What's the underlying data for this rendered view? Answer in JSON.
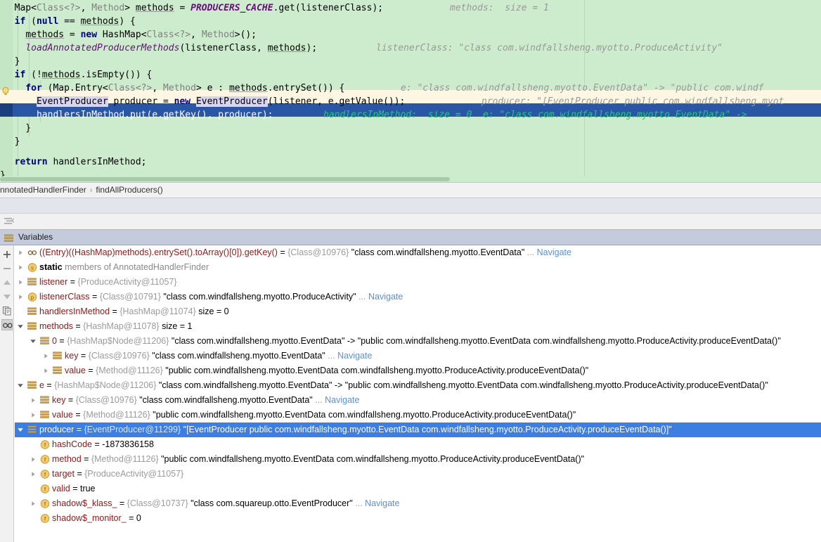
{
  "editor": {
    "lines": [
      {
        "id": "line-1",
        "code": "  Map<Class<?>, Method> methods = PRODUCERS_CACHE.get(listenerClass);",
        "hint": "methods:  size = 1"
      },
      {
        "id": "line-2",
        "code": "  if (null == methods) {",
        "hint": ""
      },
      {
        "id": "line-3",
        "code": "    methods = new HashMap<Class<?>, Method>();",
        "hint": ""
      },
      {
        "id": "line-4",
        "code": "    loadAnnotatedProducerMethods(listenerClass, methods);",
        "hint": "listenerClass: \"class com.windfallsheng.myotto.ProduceActivity\""
      },
      {
        "id": "line-5",
        "code": "  }",
        "hint": ""
      },
      {
        "id": "line-6",
        "code": "  if (!methods.isEmpty()) {",
        "hint": ""
      },
      {
        "id": "line-7",
        "code": "    for (Map.Entry<Class<?>, Method> e : methods.entrySet()) {",
        "hint": "e: \"class com.windfallsheng.myotto.EventData\" -> \"public com.windf"
      },
      {
        "id": "line-8",
        "code": "      EventProducer producer = new EventProducer(listener, e.getValue());",
        "hint": "producer: \"[EventProducer public com.windfallsheng.myot"
      },
      {
        "id": "line-9",
        "code": "      handlersInMethod.put(e.getKey(), producer);",
        "hint": "handlersInMethod:  size = 0  e: \"class com.windfallsheng.myotto.EventData\" ->"
      },
      {
        "id": "line-10",
        "code": "    }",
        "hint": ""
      },
      {
        "id": "line-11",
        "code": "  }",
        "hint": ""
      },
      {
        "id": "line-12",
        "code": "",
        "hint": ""
      },
      {
        "id": "line-13",
        "code": "  return handlersInMethod;",
        "hint": ""
      },
      {
        "id": "line-14",
        "code": "}",
        "hint": ""
      }
    ],
    "colors": {
      "background": "#cdeccd",
      "execution_line": "#2a56a6",
      "frame_line": "#fdf6e3",
      "hint_text": "#999999",
      "hint_text_selected": "#21c97a"
    }
  },
  "breadcrumb": {
    "items": [
      "nnotatedHandlerFinder",
      "findAllProducers()"
    ],
    "separator": "›"
  },
  "toolbar": {
    "sort_icon_name": "sort-lines-icon"
  },
  "variables_panel": {
    "tab_label": "Variables",
    "sidebar_buttons": [
      {
        "name": "add-watch-button",
        "glyph": "+"
      },
      {
        "name": "remove-watch-button",
        "glyph": "−"
      },
      {
        "name": "move-up-button",
        "glyph": "▲"
      },
      {
        "name": "move-down-button",
        "glyph": "▼"
      },
      {
        "name": "copy-value-button",
        "glyph": "⧉"
      },
      {
        "name": "inspect-button",
        "glyph": "∞"
      }
    ],
    "rows": [
      {
        "indent": 0,
        "twisty": "collapsed",
        "icon": "watch-expression-icon",
        "name": "((Entry)((HashMap)methods).entrySet().toArray()[0]).getKey()",
        "eq": " = ",
        "ref": "{Class@10976}",
        "value": "\"class com.windfallsheng.myotto.EventData\"",
        "ellipsis": "...",
        "navigate": "Navigate",
        "selected": false
      },
      {
        "indent": 0,
        "twisty": "collapsed",
        "icon": "static-members-icon",
        "name": "static",
        "eq": "",
        "ref": "",
        "value": "members of AnnotatedHandlerFinder",
        "ellipsis": "",
        "navigate": "",
        "selected": false,
        "style": "static"
      },
      {
        "indent": 0,
        "twisty": "collapsed",
        "icon": "object-icon",
        "name": "listener",
        "eq": " = ",
        "ref": "{ProduceActivity@11057}",
        "value": "",
        "ellipsis": "",
        "navigate": "",
        "selected": false
      },
      {
        "indent": 0,
        "twisty": "collapsed",
        "icon": "parameter-icon",
        "name": "listenerClass",
        "eq": " = ",
        "ref": "{Class@10791}",
        "value": "\"class com.windfallsheng.myotto.ProduceActivity\"",
        "ellipsis": "...",
        "navigate": "Navigate",
        "selected": false
      },
      {
        "indent": 0,
        "twisty": "none",
        "icon": "object-icon",
        "name": "handlersInMethod",
        "eq": " = ",
        "ref": "{HashMap@11074}",
        "value": "size = 0",
        "ellipsis": "",
        "navigate": "",
        "selected": false
      },
      {
        "indent": 0,
        "twisty": "expanded",
        "icon": "object-icon",
        "name": "methods",
        "eq": " = ",
        "ref": "{HashMap@11078}",
        "value": "size = 1",
        "ellipsis": "",
        "navigate": "",
        "selected": false
      },
      {
        "indent": 1,
        "twisty": "expanded",
        "icon": "object-icon",
        "name": "0",
        "eq": " = ",
        "ref": "{HashMap$Node@11206}",
        "value": "\"class com.windfallsheng.myotto.EventData\" -> \"public com.windfallsheng.myotto.EventData com.windfallsheng.myotto.ProduceActivity.produceEventData()\"",
        "ellipsis": "",
        "navigate": "",
        "selected": false
      },
      {
        "indent": 2,
        "twisty": "collapsed",
        "icon": "object-icon",
        "name": "key",
        "eq": " = ",
        "ref": "{Class@10976}",
        "value": "\"class com.windfallsheng.myotto.EventData\"",
        "ellipsis": "...",
        "navigate": "Navigate",
        "selected": false
      },
      {
        "indent": 2,
        "twisty": "collapsed",
        "icon": "object-icon",
        "name": "value",
        "eq": " = ",
        "ref": "{Method@11126}",
        "value": "\"public com.windfallsheng.myotto.EventData com.windfallsheng.myotto.ProduceActivity.produceEventData()\"",
        "ellipsis": "",
        "navigate": "",
        "selected": false
      },
      {
        "indent": 0,
        "twisty": "expanded",
        "icon": "object-icon",
        "name": "e",
        "eq": " = ",
        "ref": "{HashMap$Node@11206}",
        "value": "\"class com.windfallsheng.myotto.EventData\" -> \"public com.windfallsheng.myotto.EventData com.windfallsheng.myotto.ProduceActivity.produceEventData()\"",
        "ellipsis": "",
        "navigate": "",
        "selected": false
      },
      {
        "indent": 1,
        "twisty": "collapsed",
        "icon": "object-icon",
        "name": "key",
        "eq": " = ",
        "ref": "{Class@10976}",
        "value": "\"class com.windfallsheng.myotto.EventData\"",
        "ellipsis": "...",
        "navigate": "Navigate",
        "selected": false
      },
      {
        "indent": 1,
        "twisty": "collapsed",
        "icon": "object-icon",
        "name": "value",
        "eq": " = ",
        "ref": "{Method@11126}",
        "value": "\"public com.windfallsheng.myotto.EventData com.windfallsheng.myotto.ProduceActivity.produceEventData()\"",
        "ellipsis": "",
        "navigate": "",
        "selected": false
      },
      {
        "indent": 0,
        "twisty": "expanded",
        "icon": "object-icon",
        "name": "producer",
        "eq": " = ",
        "ref": "{EventProducer@11299}",
        "value": "\"[EventProducer public com.windfallsheng.myotto.EventData com.windfallsheng.myotto.ProduceActivity.produceEventData()]\"",
        "ellipsis": "",
        "navigate": "",
        "selected": true
      },
      {
        "indent": 1,
        "twisty": "none",
        "icon": "field-icon",
        "name": "hashCode",
        "eq": " = ",
        "ref": "",
        "value": "-1873836158",
        "ellipsis": "",
        "navigate": "",
        "selected": false
      },
      {
        "indent": 1,
        "twisty": "collapsed",
        "icon": "field-icon",
        "name": "method",
        "eq": " = ",
        "ref": "{Method@11126}",
        "value": "\"public com.windfallsheng.myotto.EventData com.windfallsheng.myotto.ProduceActivity.produceEventData()\"",
        "ellipsis": "",
        "navigate": "",
        "selected": false
      },
      {
        "indent": 1,
        "twisty": "collapsed",
        "icon": "field-icon",
        "name": "target",
        "eq": " = ",
        "ref": "{ProduceActivity@11057}",
        "value": "",
        "ellipsis": "",
        "navigate": "",
        "selected": false
      },
      {
        "indent": 1,
        "twisty": "none",
        "icon": "field-icon",
        "name": "valid",
        "eq": " = ",
        "ref": "",
        "value": "true",
        "ellipsis": "",
        "navigate": "",
        "selected": false
      },
      {
        "indent": 1,
        "twisty": "collapsed",
        "icon": "field-icon",
        "name": "shadow$_klass_",
        "eq": " = ",
        "ref": "{Class@10737}",
        "value": "\"class com.squareup.otto.EventProducer\"",
        "ellipsis": "...",
        "navigate": "Navigate",
        "selected": false
      },
      {
        "indent": 1,
        "twisty": "none",
        "icon": "field-icon",
        "name": "shadow$_monitor_",
        "eq": " = ",
        "ref": "",
        "value": "0",
        "ellipsis": "",
        "navigate": "",
        "selected": false
      }
    ]
  }
}
